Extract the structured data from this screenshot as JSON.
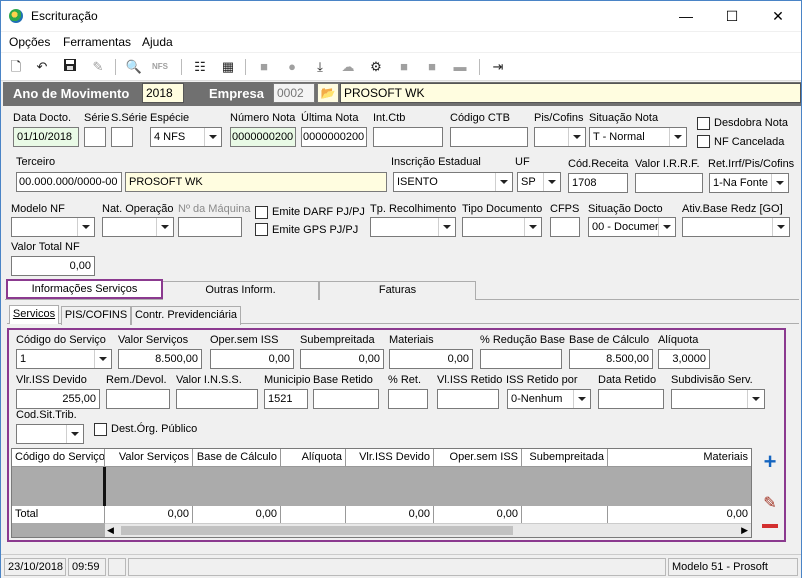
{
  "window": {
    "title": "Escrituração",
    "minimize": "—",
    "maximize": "☐",
    "close": "✕"
  },
  "menu": [
    "Opções",
    "Ferramentas",
    "Ajuda"
  ],
  "toolbar": {
    "new": "🗋",
    "undo": "↶",
    "save": "💾",
    "nfs": "NFS"
  },
  "header": {
    "ano_label": "Ano de Movimento",
    "ano_value": "2018",
    "empresa_label": "Empresa",
    "empresa_code": "0002",
    "empresa_name": "PROSOFT WK"
  },
  "labels": {
    "data_docto": "Data Docto.",
    "serie": "Série",
    "s_serie": "S.Série",
    "especie": "Espécie",
    "numero_nota": "Número Nota",
    "ultima_nota": "Última Nota",
    "int_ctb": "Int.Ctb",
    "codigo_ctb": "Código CTB",
    "pis_cofins": "Pis/Cofins",
    "situacao_nota": "Situação Nota",
    "desdobra_nota": "Desdobra Nota",
    "nf_cancelada": "NF Cancelada",
    "terceiro": "Terceiro",
    "inscricao_estadual": "Inscrição Estadual",
    "uf": "UF",
    "cod_receita": "Cód.Receita",
    "valor_irrf": "Valor I.R.R.F.",
    "ret_irrf": "Ret.Irrf/Pis/Cofins",
    "modelo_nf": "Modelo NF",
    "nat_operacao": "Nat. Operação",
    "n_maquina": "Nº da Máquina",
    "emite_darf": "Emite DARF PJ/PJ",
    "emite_gps": "Emite GPS PJ/PJ",
    "tp_recolhimento": "Tp. Recolhimento",
    "tipo_documento": "Tipo Documento",
    "cfps": "CFPS",
    "situacao_docto": "Situação Docto",
    "ativ_base": "Ativ.Base Redz [GO]",
    "valor_total_nf": "Valor Total NF"
  },
  "values": {
    "data_docto": "01/10/2018",
    "especie": "4 NFS",
    "numero_nota": "0000000200",
    "ultima_nota": "0000000200",
    "situacao_nota": "T - Normal",
    "terceiro_doc": "00.000.000/0000-00",
    "terceiro_nome": "PROSOFT WK",
    "inscricao_estadual": "ISENTO",
    "uf": "SP",
    "cod_receita": "1708",
    "ret_irrf": "1-Na Fonte",
    "situacao_docto": "00 - Documer",
    "valor_total_nf": "0,00"
  },
  "tabs": {
    "main": [
      "Informações Serviços",
      "Outras Inform.",
      "Faturas"
    ],
    "sub": [
      "Servicos",
      "PIS/COFINS",
      "Contr. Previdenciária"
    ]
  },
  "servicos": {
    "labels": {
      "codigo_servico": "Código do Serviço",
      "valor_servicos": "Valor Serviços",
      "oper_sem_iss": "Oper.sem ISS",
      "subempreitada": "Subempreitada",
      "materiais": "Materiais",
      "reducao_base": "% Redução Base",
      "base_calculo": "Base de Cálculo",
      "aliquota": "Alíquota",
      "vlr_iss_devido": "Vlr.ISS Devido",
      "rem_devol": "Rem./Devol.",
      "valor_inss": "Valor I.N.S.S.",
      "municipio": "Municipio",
      "base_retido": "Base Retido",
      "pct_ret": "% Ret.",
      "vl_iss_retido": "Vl.ISS Retido",
      "iss_retido_por": "ISS Retido por",
      "data_retido": "Data Retido",
      "subdivisao": "Subdivisão Serv.",
      "cod_sit_trib": "Cod.Sit.Trib.",
      "dest_org": "Dest.Órg. Público"
    },
    "values": {
      "codigo_servico": "1",
      "valor_servicos": "8.500,00",
      "oper_sem_iss": "0,00",
      "subempreitada": "0,00",
      "materiais": "0,00",
      "base_calculo": "8.500,00",
      "aliquota": "3,0000",
      "vlr_iss_devido": "255,00",
      "municipio": "1521",
      "iss_retido_por": "0-Nenhum"
    }
  },
  "grid": {
    "columns": [
      "Código do Serviço",
      "Valor Serviços",
      "Base de Cálculo",
      "Alíquota",
      "Vlr.ISS Devido",
      "Oper.sem ISS",
      "Subempreitada",
      "Materiais"
    ],
    "total_label": "Total",
    "totals": [
      "0,00",
      "0,00",
      "",
      "0,00",
      "0,00",
      "",
      "0,00"
    ]
  },
  "status": {
    "date": "23/10/2018",
    "time": "09:59",
    "model": "Modelo 51 - Prosoft"
  },
  "colors": {
    "highlight_border": "#8b3a8f",
    "add": "#1565c0",
    "remove": "#d32f2f"
  }
}
